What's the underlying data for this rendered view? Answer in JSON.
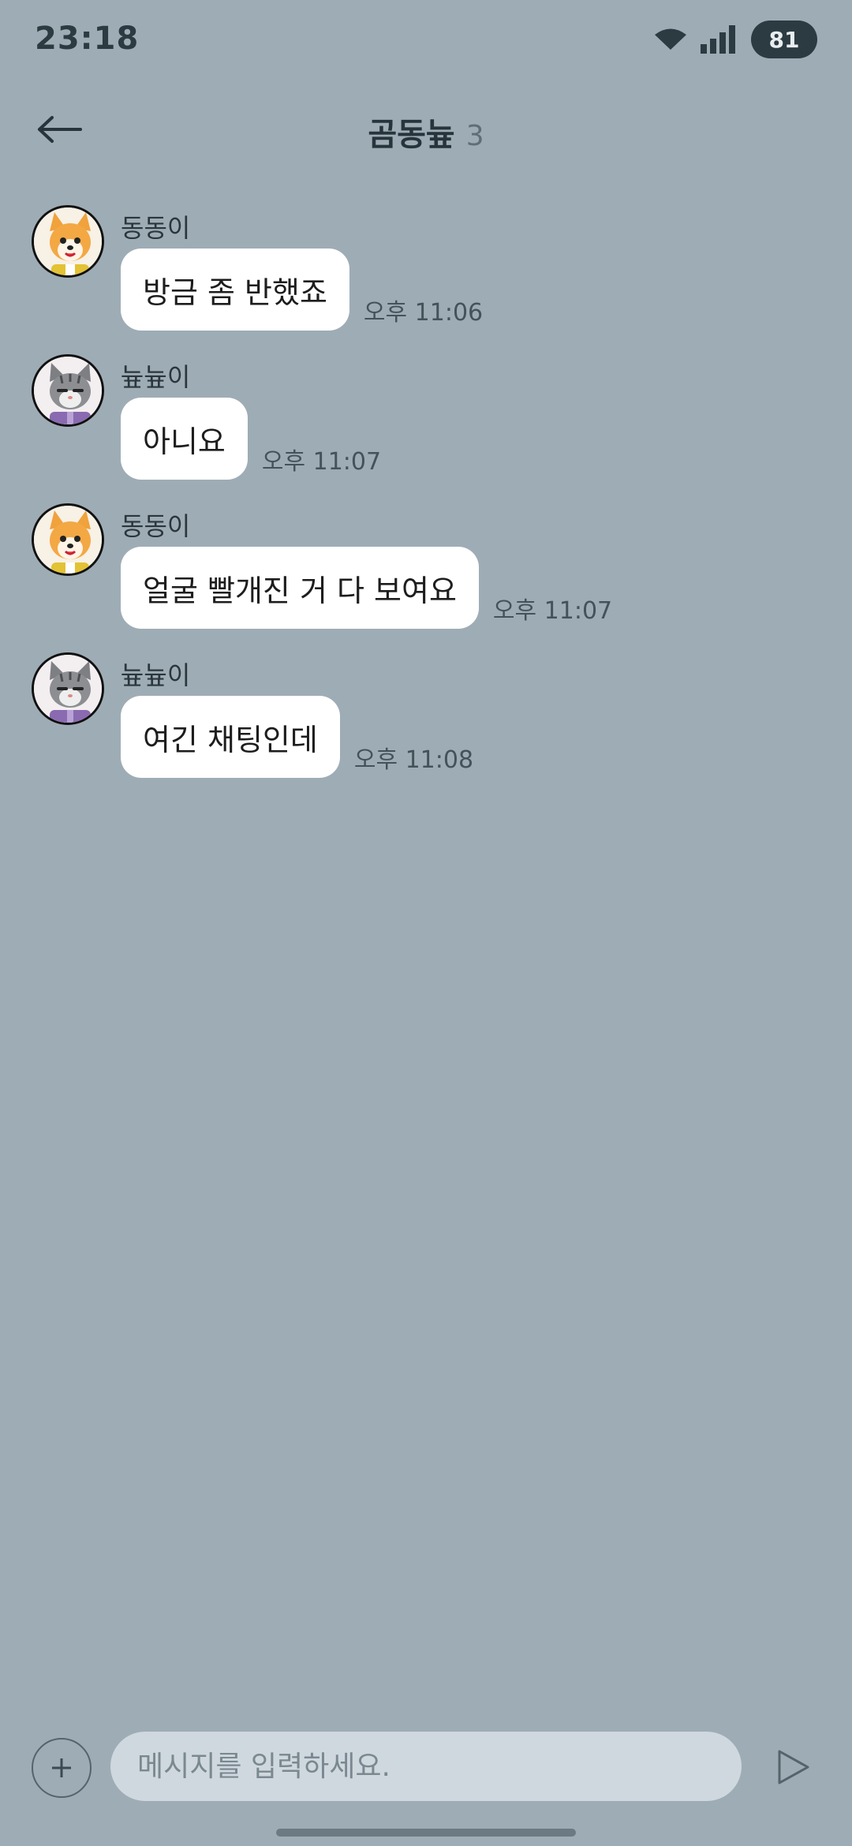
{
  "status_bar": {
    "time": "23:18",
    "battery": "81",
    "icons": [
      "wifi-icon",
      "signal-icon",
      "battery-icon"
    ]
  },
  "header": {
    "back_icon": "arrow-left-icon",
    "title": "곰동늎",
    "member_count": "3"
  },
  "messages": [
    {
      "sender": "동동이",
      "avatar": "dog-avatar",
      "text": "방금 좀 반했죠",
      "time": "오후 11:06"
    },
    {
      "sender": "늎늎이",
      "avatar": "cat-avatar",
      "text": "아니요",
      "time": "오후 11:07"
    },
    {
      "sender": "동동이",
      "avatar": "dog-avatar",
      "text": "얼굴 빨개진 거 다 보여요",
      "time": "오후 11:07"
    },
    {
      "sender": "늎늎이",
      "avatar": "cat-avatar",
      "text": "여긴 채팅인데",
      "time": "오후 11:08"
    }
  ],
  "input_bar": {
    "plus_icon": "plus-icon",
    "placeholder": "메시지를 입력하세요.",
    "value": "",
    "send_icon": "send-icon"
  },
  "colors": {
    "background": "#9eacb5",
    "bubble": "#ffffff",
    "input": "#cfd8de",
    "text_dark": "#27343b"
  }
}
